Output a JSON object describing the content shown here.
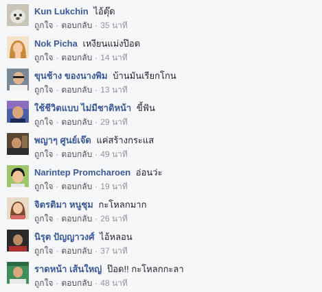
{
  "labels": {
    "like": "ถูกใจ",
    "separator": "·",
    "reply": "ตอบกลับ"
  },
  "comments": [
    {
      "author": "Kun Lukchin",
      "text": "ไอ้ตุ๊ด",
      "time": "35 นาที"
    },
    {
      "author": "Nok Picha",
      "text": "เหงียนแม่งป๊อด",
      "time": "14 นาที"
    },
    {
      "author": "ขุนช้าง ของนางพิม",
      "text": "บ้านมันเรียกโกน",
      "time": "13 นาที"
    },
    {
      "author": "ใช้ชีวิตแบบ ไม่มีชาติหน้า",
      "text": "ขี้ฟัน",
      "time": "29 นาที"
    },
    {
      "author": "พญาๆ ศูนย์เจ๊ด",
      "text": "แค่สร้างกระแส",
      "time": "49 นาที"
    },
    {
      "author": "Narintep Promcharoen",
      "text": "อ่อนว่ะ",
      "time": "19 นาที"
    },
    {
      "author": "จิตรติมา หนูชุม",
      "text": "กะโหลกมาก",
      "time": "26 นาที"
    },
    {
      "author": "นิรุต ปัญญาวงศ์",
      "text": "ไอ้หลอน",
      "time": "37 นาที"
    },
    {
      "author": "ราดหน้า เส้นใหญ่",
      "text": "ป๊อด!! กะโหลกกะลา",
      "time": "48 นาที"
    }
  ]
}
